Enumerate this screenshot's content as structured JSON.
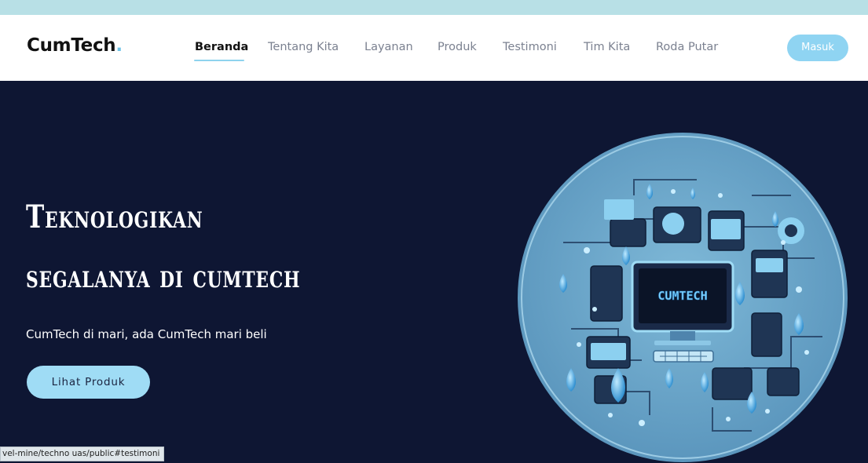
{
  "brand": {
    "name": "CumTech",
    "dot": "."
  },
  "nav": {
    "items": [
      {
        "label": "Beranda",
        "active": true
      },
      {
        "label": "Tentang Kita",
        "active": false
      },
      {
        "label": "Layanan",
        "active": false
      },
      {
        "label": "Produk",
        "active": false
      },
      {
        "label": "Testimoni",
        "active": false
      },
      {
        "label": "Tim Kita",
        "active": false
      },
      {
        "label": "Roda Putar",
        "active": false
      }
    ],
    "login_label": "Masuk"
  },
  "hero": {
    "headline_line1": "Teknologikan",
    "headline_line2": "segalanya di cumtech",
    "subtitle": "CumTech di mari, ada CumTech mari beli",
    "cta_label": "Lihat Produk",
    "illustration_text": "CUMTECH"
  },
  "status_bar": {
    "url": "vel-mine/techno uas/public#testimoni"
  },
  "colors": {
    "hero_bg": "#0e1633",
    "accent": "#8fd4f2",
    "top_strip": "#b8e0e6"
  },
  "icons": [
    "computer-monitor-icon",
    "water-drop-icon",
    "speaker-icon",
    "keyboard-icon"
  ]
}
